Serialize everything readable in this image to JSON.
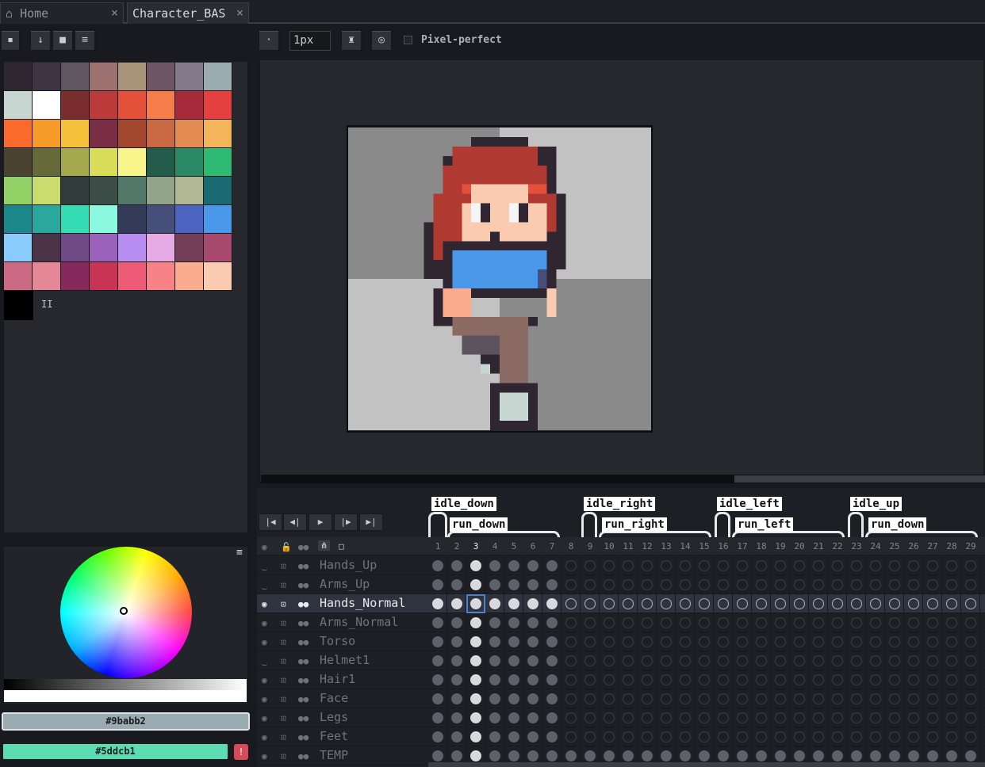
{
  "tabs": [
    {
      "label": "Home",
      "icon": "home-icon"
    },
    {
      "label": "Character_BAS",
      "icon": ""
    }
  ],
  "toolbar": {
    "brush_size": "1px",
    "pixel_perfect_label": "Pixel-perfect",
    "pixel_perfect_checked": false
  },
  "palette": {
    "colors": [
      "#2f2632",
      "#3d3543",
      "#605660",
      "#9e7171",
      "#a99379",
      "#6e5564",
      "#837a8c",
      "#9babb2",
      "#c7d6d0",
      "#ffffff",
      "#7a2d2d",
      "#bb3a3a",
      "#e4513b",
      "#f47d4a",
      "#a72a3a",
      "#e63f3f",
      "#fa6a2a",
      "#f69a2a",
      "#f5c03a",
      "#7a2e45",
      "#a2472e",
      "#c96944",
      "#e28c54",
      "#f4b55a",
      "#4a4332",
      "#666a3b",
      "#a5a84c",
      "#d8dc58",
      "#f8f68a",
      "#245c4c",
      "#2a8a67",
      "#2eba73",
      "#92d165",
      "#cadc6e",
      "#313c3a",
      "#3c4d48",
      "#52786a",
      "#92a48a",
      "#b2b894",
      "#1a6a72",
      "#1b878a",
      "#2aa89d",
      "#35ddb5",
      "#8cf8e0",
      "#333b58",
      "#464e7a",
      "#4d65c0",
      "#4a98ea",
      "#89cbfb",
      "#4c3448",
      "#704a84",
      "#9b62bb",
      "#b88ef2",
      "#e6aae4",
      "#743e58",
      "#a74a6d",
      "#cc6a84",
      "#e48797",
      "#862a5e",
      "#c83455",
      "#ed5a75",
      "#f78386",
      "#fbac8f",
      "#fbcbb1"
    ],
    "extra_glyph": "II"
  },
  "colorpicker": {
    "foreground": "#9babb2",
    "background": "#5ddcb1",
    "menu": "≡",
    "warn": "!"
  },
  "tags": [
    {
      "label": "idle_down"
    },
    {
      "label": "run_down"
    },
    {
      "label": "idle_right"
    },
    {
      "label": "run_right"
    },
    {
      "label": "idle_left"
    },
    {
      "label": "run_left"
    },
    {
      "label": "idle_up"
    },
    {
      "label": "run_down"
    }
  ],
  "frames": [
    "1",
    "2",
    "3",
    "4",
    "5",
    "6",
    "7",
    "8",
    "9",
    "10",
    "11",
    "12",
    "13",
    "14",
    "15",
    "16",
    "17",
    "18",
    "19",
    "20",
    "21",
    "22",
    "23",
    "24",
    "25",
    "26",
    "27",
    "28",
    "29"
  ],
  "current_frame": 3,
  "layers": [
    {
      "name": "Hands_Up",
      "visible": false,
      "sel": false
    },
    {
      "name": "Arms_Up",
      "visible": false,
      "sel": false
    },
    {
      "name": "Hands_Normal",
      "visible": true,
      "sel": true
    },
    {
      "name": "Arms_Normal",
      "visible": true,
      "sel": false
    },
    {
      "name": "Torso",
      "visible": true,
      "sel": false
    },
    {
      "name": "Helmet1",
      "visible": false,
      "sel": false
    },
    {
      "name": "Hair1",
      "visible": true,
      "sel": false
    },
    {
      "name": "Face",
      "visible": true,
      "sel": false
    },
    {
      "name": "Legs",
      "visible": true,
      "sel": false
    },
    {
      "name": "Feet",
      "visible": true,
      "sel": false
    },
    {
      "name": "TEMP",
      "visible": true,
      "sel": false
    }
  ]
}
